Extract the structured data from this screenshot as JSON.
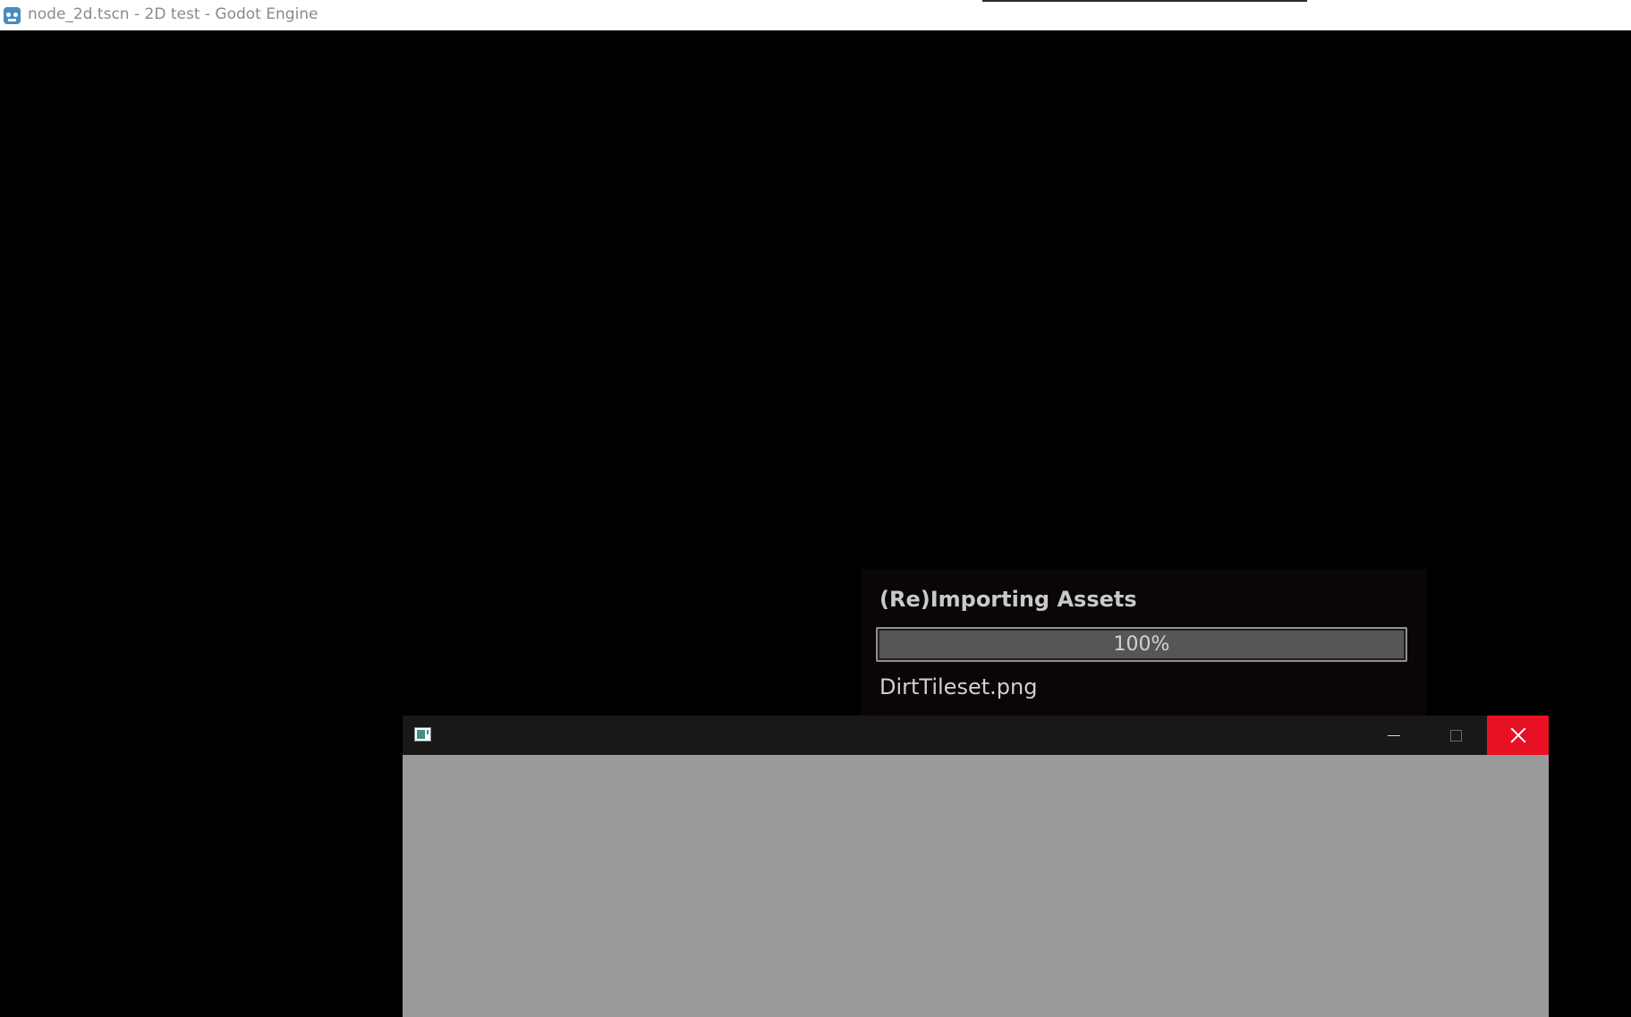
{
  "main_window": {
    "title": "node_2d.tscn - 2D test - Godot Engine",
    "icon": "godot-icon"
  },
  "import_dialog": {
    "heading": "(Re)Importing Assets",
    "progress_text": "100%",
    "progress_fraction": 1.0,
    "current_file": "DirtTileset.png"
  },
  "game_window": {
    "title": "",
    "icon": "app-window-icon",
    "controls": {
      "minimize_icon": "minimize-icon",
      "maximize_icon": "maximize-icon",
      "close_icon": "close-icon"
    },
    "close_color": "#e81123",
    "viewport_color": "#9a9a9a"
  }
}
